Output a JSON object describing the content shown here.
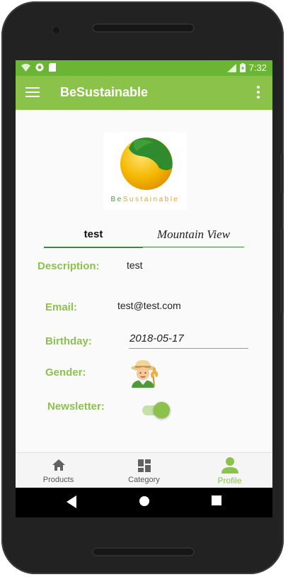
{
  "statusbar": {
    "time": "7:32"
  },
  "appbar": {
    "title": "BeSustainable"
  },
  "logo": {
    "text_part1": "Be",
    "text_part2": "Sustainable"
  },
  "profile": {
    "username": "test",
    "location": "Mountain View",
    "description_label": "Description:",
    "description_value": "test",
    "email_label": "Email:",
    "email_value": "test@test.com",
    "birthday_label": "Birthday:",
    "birthday_value": "2018-05-17",
    "gender_label": "Gender:",
    "newsletter_label": "Newsletter:",
    "newsletter_enabled": true
  },
  "bottom_nav": {
    "items": [
      {
        "label": "Products",
        "icon": "home-icon"
      },
      {
        "label": "Category",
        "icon": "dashboard-icon"
      },
      {
        "label": "Profile",
        "icon": "person-icon"
      }
    ],
    "active": "Profile"
  },
  "colors": {
    "primary": "#8bc34a",
    "status_bar": "#6ab534",
    "underline": "#3d8a3d"
  }
}
